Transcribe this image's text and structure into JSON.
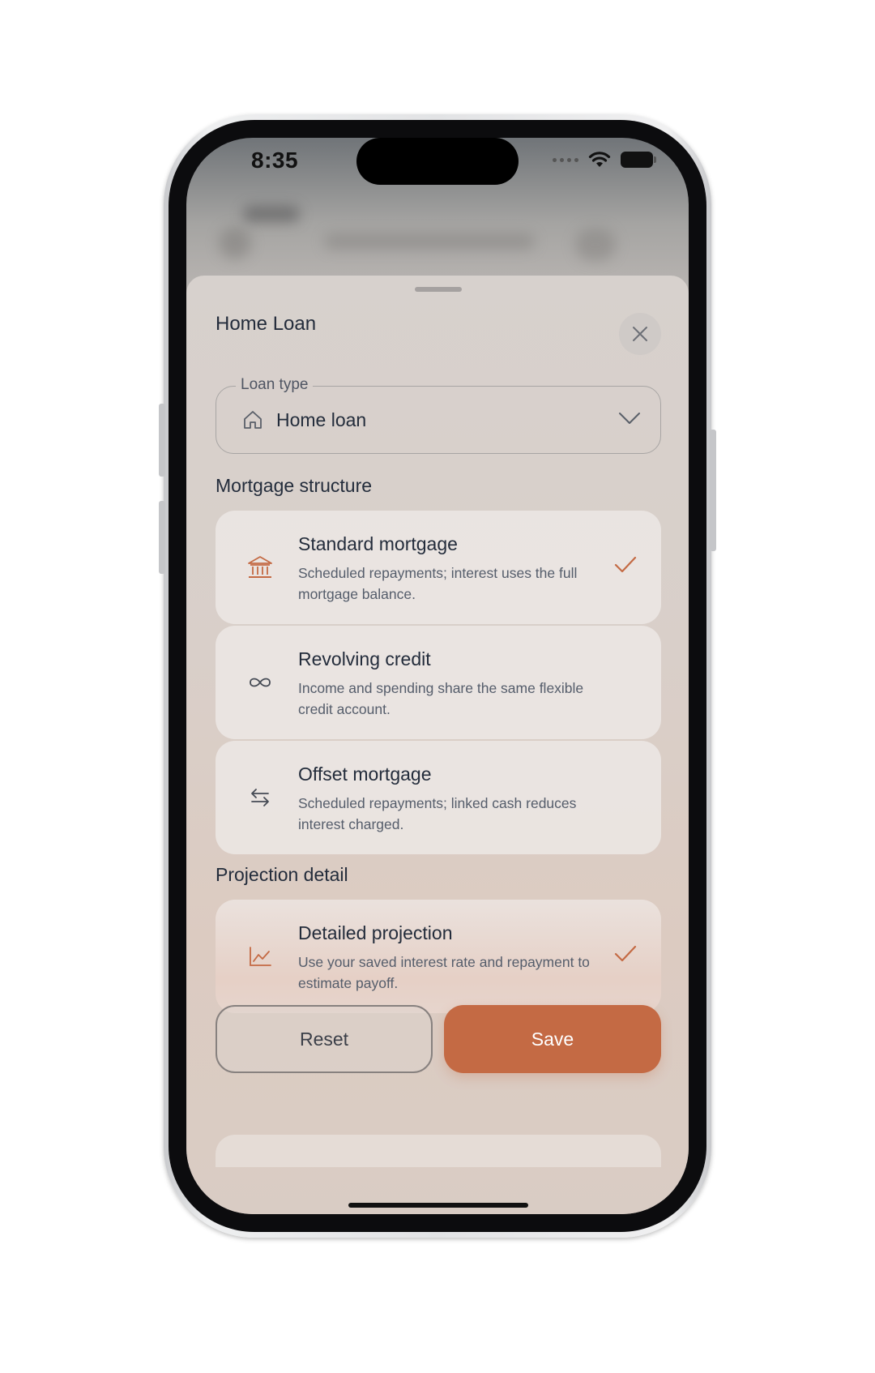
{
  "status_bar": {
    "time": "8:35"
  },
  "sheet": {
    "title": "Home Loan",
    "loan_type": {
      "label": "Loan type",
      "value": "Home loan"
    },
    "sections": {
      "mortgage_structure": "Mortgage structure",
      "projection_detail": "Projection detail"
    },
    "mortgage_options": [
      {
        "title": "Standard mortgage",
        "description": "Scheduled repayments; interest uses the full mortgage balance.",
        "icon": "bank-icon",
        "selected": true
      },
      {
        "title": "Revolving credit",
        "description": "Income and spending share the same flexible credit account.",
        "icon": "infinity-icon",
        "selected": false
      },
      {
        "title": "Offset mortgage",
        "description": "Scheduled repayments; linked cash reduces interest charged.",
        "icon": "swap-arrows-icon",
        "selected": false
      }
    ],
    "projection_options": [
      {
        "title": "Detailed projection",
        "description": "Use your saved interest rate and repayment to estimate payoff.",
        "icon": "line-chart-icon",
        "selected": true
      }
    ],
    "buttons": {
      "reset": "Reset",
      "save": "Save"
    }
  },
  "colors": {
    "accent": "#c46a44",
    "text": "#232c3b",
    "muted_text": "#555d6b"
  }
}
